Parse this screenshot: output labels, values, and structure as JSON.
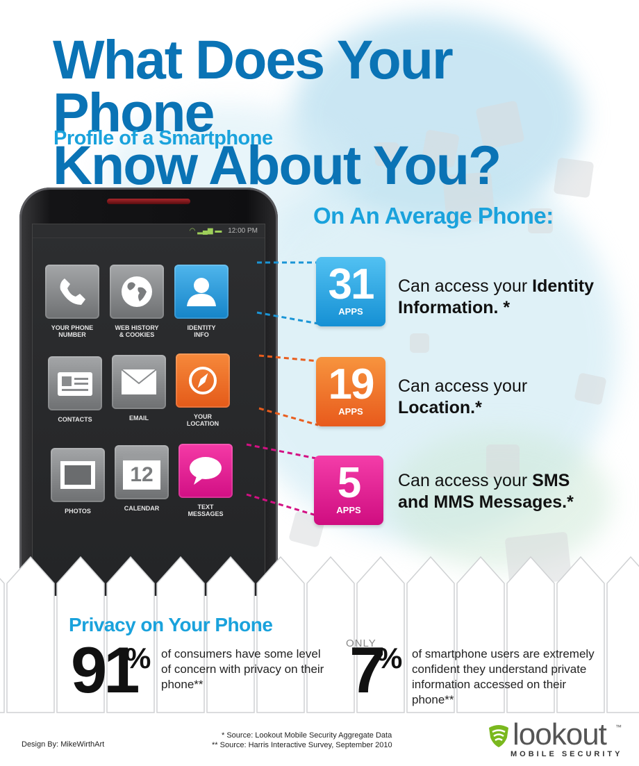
{
  "title": {
    "line1": "What Does Your Phone",
    "line2": "Know About You?"
  },
  "subtitle": "Profile of a Smartphone",
  "phone": {
    "status_time": "12:00 PM",
    "apps": [
      {
        "label": "YOUR PHONE\nNUMBER",
        "icon": "phone-handset-icon"
      },
      {
        "label": "WEB HISTORY\n& COOKIES",
        "icon": "globe-icon"
      },
      {
        "label": "IDENTITY\nINFO",
        "icon": "person-icon"
      },
      {
        "label": "CONTACTS",
        "icon": "contacts-card-icon"
      },
      {
        "label": "EMAIL",
        "icon": "envelope-icon"
      },
      {
        "label": "YOUR\nLOCATION",
        "icon": "compass-icon"
      },
      {
        "label": "PHOTOS",
        "icon": "photo-frame-icon"
      },
      {
        "label": "CALENDAR",
        "icon": "calendar-icon",
        "day": "12"
      },
      {
        "label": "TEXT\nMESSAGES",
        "icon": "speech-bubble-icon"
      }
    ]
  },
  "average": {
    "heading": "On An Average Phone:",
    "stats": [
      {
        "value": "31",
        "unit": "APPS",
        "text_plain": "Can access your ",
        "text_bold": "Identity Information.",
        "text_tail": " *",
        "color": "#1a95d6"
      },
      {
        "value": "19",
        "unit": "APPS",
        "text_plain": "Can access your ",
        "text_bold": "Location.*",
        "text_tail": "",
        "color": "#e95d1d"
      },
      {
        "value": "5",
        "unit": "APPS",
        "text_plain": "Can access your ",
        "text_bold": "SMS and MMS Messages.*",
        "text_tail": "",
        "color": "#d31083"
      }
    ]
  },
  "privacy": {
    "heading": "Privacy on Your Phone",
    "left": {
      "number": "91",
      "percent": "%",
      "text": "of consumers have some level of concern with privacy on their phone**"
    },
    "right": {
      "prefix": "ONLY",
      "number": "7",
      "percent": "%",
      "text": "of smartphone users are extremely confident they understand private information accessed on their phone**"
    }
  },
  "footer": {
    "design": "Design By: MikeWirthArt",
    "source1": "* Source: Lookout Mobile Security Aggregate Data",
    "source2": "** Source: Harris Interactive Survey, September 2010",
    "logo_word": "lookout",
    "logo_tm": "™",
    "logo_sub": "MOBILE SECURITY"
  },
  "colors": {
    "title": "#0a73b5",
    "accent": "#1aa2dc",
    "orange": "#e95d1d",
    "pink": "#d31083"
  }
}
